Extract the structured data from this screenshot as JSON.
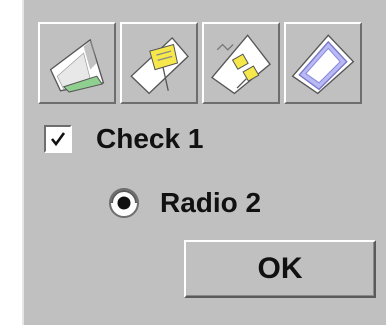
{
  "toolbar": {
    "icons": [
      {
        "name": "notebook-icon"
      },
      {
        "name": "paper-label-icon"
      },
      {
        "name": "paper-clips-icon"
      },
      {
        "name": "picture-frame-icon"
      }
    ]
  },
  "controls": {
    "check1": {
      "label": "Check 1",
      "checked": true
    },
    "radio2": {
      "label": "Radio 2",
      "selected": true
    },
    "ok_label": "OK"
  },
  "colors": {
    "panel_bg": "#c0c0c0",
    "accent_green": "#8fcf8f",
    "accent_yellow": "#f6e84a",
    "accent_blue": "#b9b9f5"
  }
}
